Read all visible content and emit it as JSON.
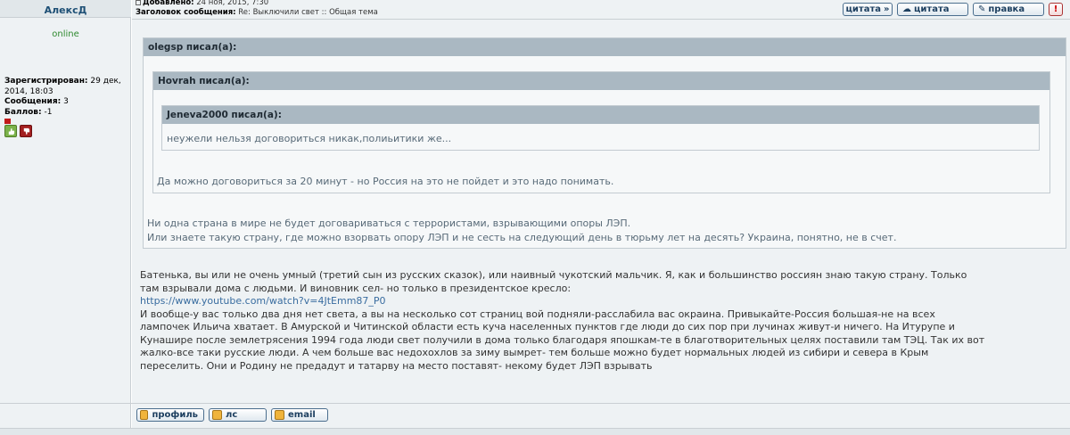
{
  "user": {
    "name": "АлексД",
    "status": "online",
    "registered_label": "Зарегистрирован:",
    "registered_value": "29 дек, 2014, 18:03",
    "posts_label": "Сообщения:",
    "posts_value": "3",
    "points_label": "Баллов:",
    "points_value": "-1"
  },
  "post": {
    "added_label": "Добавлено:",
    "added_value": "24 ноя, 2015, 7:30",
    "subject_label": "Заголовок сообщения:",
    "subject_value": "Re: Выключили свет :: Общая тема"
  },
  "toolbar": {
    "quote_selected": "цитата",
    "quote": "цитата",
    "edit": "правка",
    "report": "!"
  },
  "quotes": {
    "outer_author": "olegsp писал(а):",
    "middle_author": "Hovrah писал(а):",
    "inner_author": "Jeneva2000 писал(а):",
    "inner_text": "неужели нельзя договориться никак,полиьитики же...",
    "middle_text": "Да можно договориться за 20 минут - но Россия на это не пойдет и это надо понимать.",
    "outer_text_1": "Ни одна страна в мире не будет договариваться с террористами, взрывающими опоры ЛЭП.",
    "outer_text_2": "Или знаете такую страну, где можно взорвать опору ЛЭП и не сесть на следующий день в тюрьму лет на десять? Украина, понятно, не в счет."
  },
  "body": {
    "line1": "Батенька, вы или не очень умный (третий сын из русских сказок), или наивный чукотский мальчик. Я, как и большинство россиян знаю такую страну. Только",
    "line2": "там взрывали дома с людьми. И виновник сел- но только в президентское кресло:",
    "link": "https://www.youtube.com/watch?v=4JtEmm87_P0",
    "line3": "И вообще-у вас только два дня нет света, а вы на несколько сот страниц вой подняли-расслабила вас окраина. Привыкайте-Россия большая-не на всех",
    "line4": "лампочек Ильича хватает. В Амурской и Читинской области есть куча населенных пунктов где люди до сих пор при лучинах живут-и ничего. На Итурупе и",
    "line5": "Кунашире после землетрясения 1994 года люди свет получили в дома только благодаря япошкам-те в благотворительных целях поставили там ТЭЦ. Так их вот",
    "line6": "жалко-все таки русские люди. А чем больше вас недохохлов за зиму вымрет- тем больше можно будет нормальных людей из сибири и севера в Крым",
    "line7": "переселить. Они и Родину не предадут и татарву на место поставят- некому будет ЛЭП взрывать"
  },
  "footer_buttons": {
    "profile": "профиль",
    "pm": "лс",
    "email": "email"
  }
}
